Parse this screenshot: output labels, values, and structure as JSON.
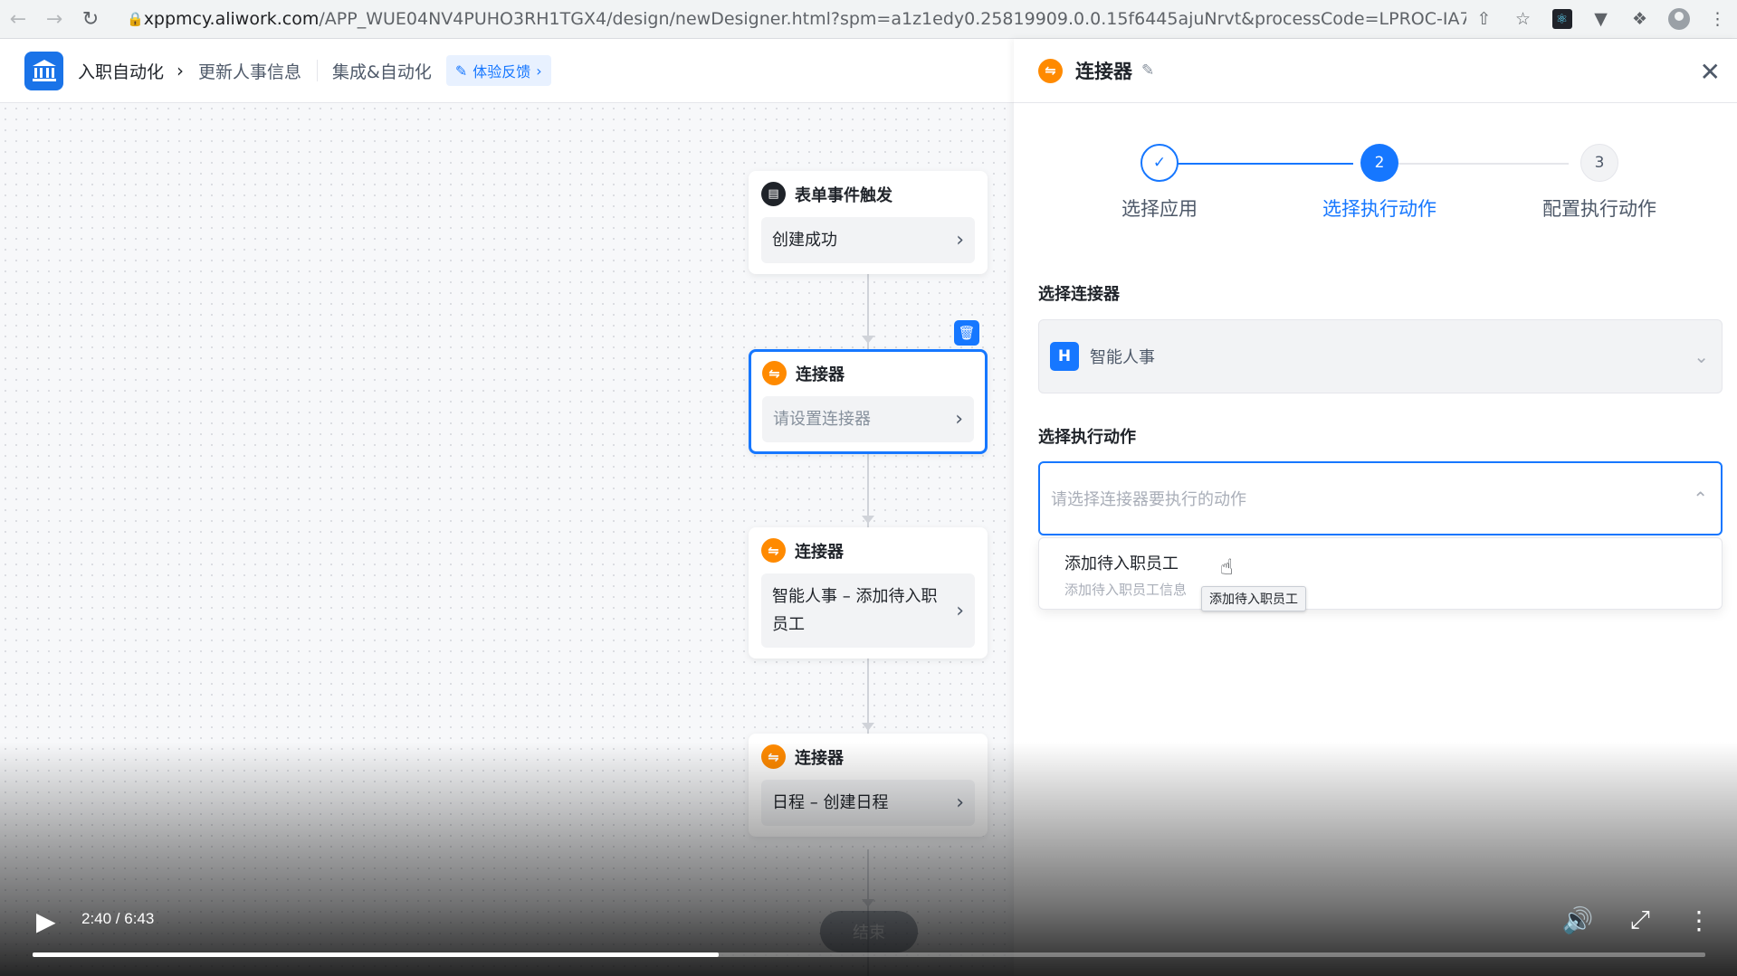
{
  "browser": {
    "url_host": "xppmcy.aliwork.com",
    "url_rest": "/APP_WUE04NV4PUHO3RH1TGX4/design/newDesigner.html?spm=a1z1edy0.25819909.0.0.15f6445ajuNrvt&processCode=LPROC-IA76..."
  },
  "header": {
    "app_name": "入职自动化",
    "page_name": "更新人事信息",
    "section": "集成&自动化",
    "feedback_label": "体验反馈"
  },
  "flow": {
    "nodes": [
      {
        "title": "表单事件触发",
        "body": "创建成功"
      },
      {
        "title": "连接器",
        "body": "请设置连接器"
      },
      {
        "title": "连接器",
        "body": "智能人事 – 添加待入职员工"
      },
      {
        "title": "连接器",
        "body": "日程 – 创建日程"
      }
    ],
    "end_label": "结束"
  },
  "panel": {
    "title": "连接器",
    "steps": [
      {
        "number": "✓",
        "label": "选择应用",
        "state": "done"
      },
      {
        "number": "2",
        "label": "选择执行动作",
        "state": "active"
      },
      {
        "number": "3",
        "label": "配置执行动作",
        "state": "todo"
      }
    ],
    "connector_label": "选择连接器",
    "connector_badge": "H",
    "connector_value": "智能人事",
    "action_label": "选择执行动作",
    "action_placeholder": "请选择连接器要执行的动作",
    "options": [
      {
        "title": "添加待入职员工",
        "desc": "添加待入职员工信息"
      }
    ],
    "tooltip": "添加待入职员工"
  },
  "video": {
    "time": "2:40 / 6:43",
    "progress": 0.41
  },
  "colors": {
    "accent": "#1677ff",
    "connector_orange": "#ff8a00"
  }
}
